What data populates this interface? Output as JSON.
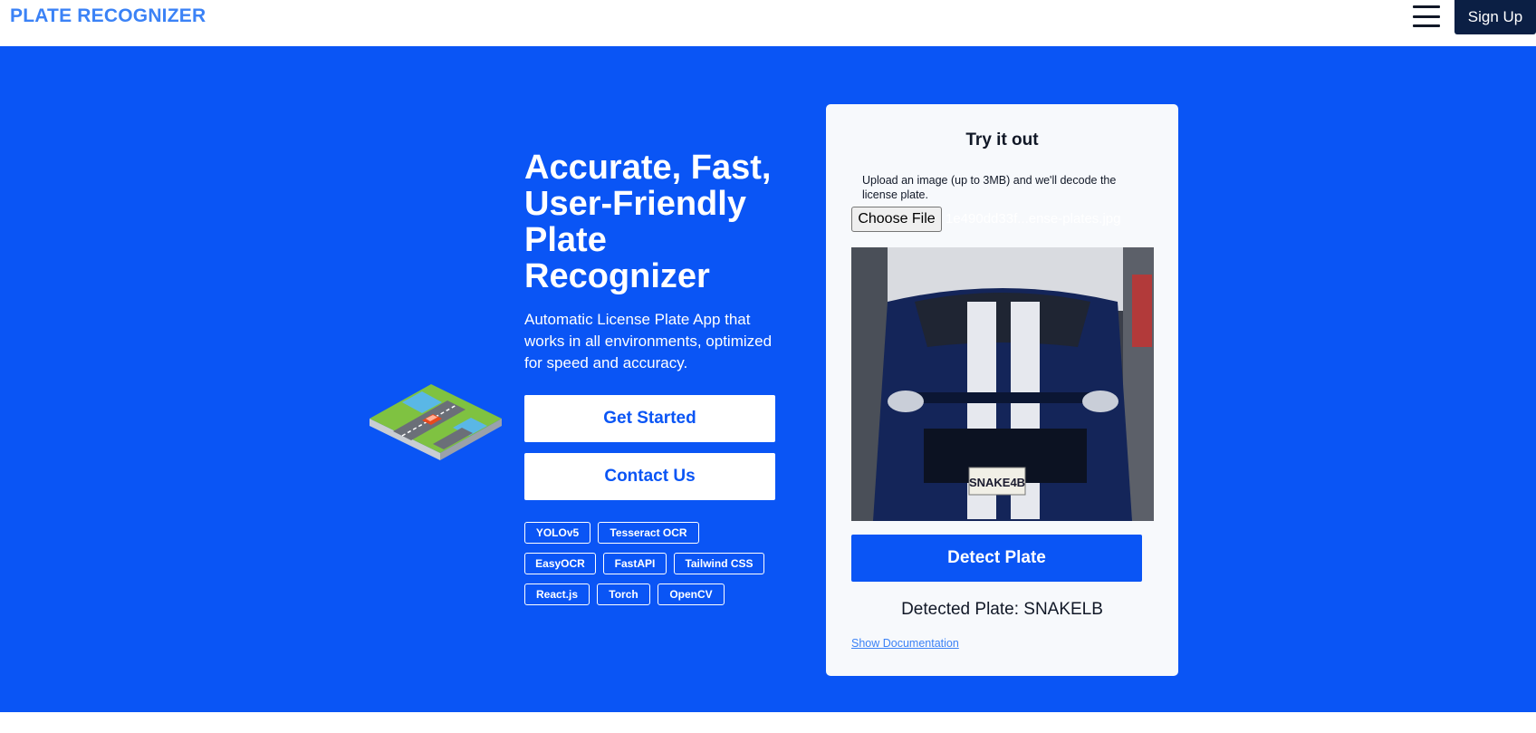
{
  "header": {
    "logo": "PLATE RECOGNIZER",
    "menu_icon": "hamburger-menu-icon",
    "signup_label": "Sign Up"
  },
  "hero": {
    "title": "Accurate, Fast, User-Friendly Plate Recognizer",
    "subtitle": "Automatic License Plate App that works in all environments, optimized for speed and accuracy.",
    "illustration_icon": "isometric-road-car-icon",
    "get_started_label": "Get Started",
    "contact_label": "Contact Us",
    "tags": [
      [
        "YOLOv5",
        "Tesseract OCR"
      ],
      [
        "EasyOCR",
        "FastAPI",
        "Tailwind CSS"
      ],
      [
        "React.js",
        "Torch",
        "OpenCV"
      ]
    ]
  },
  "card": {
    "title": "Try it out",
    "description": "Upload an image (up to 3MB) and we'll decode the license plate.",
    "choose_file_label": "Choose File",
    "file_name": "1e490dd33f...ense-plates.jpg",
    "detect_label": "Detect Plate",
    "detected_text": "Detected Plate: SNAKELB",
    "doc_link": "Show Documentation"
  },
  "photo": {
    "plate_text": "SNAKE4B"
  },
  "colors": {
    "brand_blue": "#0a55f5",
    "logo_blue": "#3b82f6",
    "navy": "#0b1f44"
  }
}
